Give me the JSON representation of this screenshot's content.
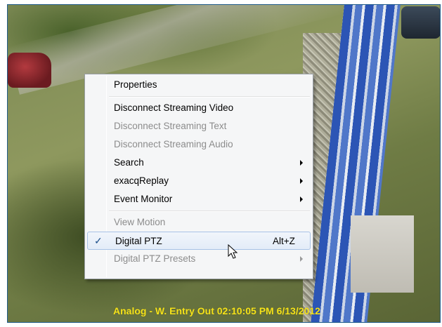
{
  "video": {
    "overlay_caption": "Analog - W. Entry Out 02:10:05 PM 6/13/2012"
  },
  "context_menu": {
    "items": [
      {
        "label": "Properties",
        "disabled": false,
        "submenu": false
      },
      {
        "label": "Disconnect Streaming Video",
        "disabled": false,
        "submenu": false
      },
      {
        "label": "Disconnect Streaming Text",
        "disabled": true,
        "submenu": false
      },
      {
        "label": "Disconnect Streaming Audio",
        "disabled": true,
        "submenu": false
      },
      {
        "label": "Search",
        "disabled": false,
        "submenu": true
      },
      {
        "label": "exacqReplay",
        "disabled": false,
        "submenu": true
      },
      {
        "label": "Event Monitor",
        "disabled": false,
        "submenu": true
      },
      {
        "label": "View Motion",
        "disabled": true,
        "submenu": false
      },
      {
        "label": "Digital PTZ",
        "disabled": false,
        "submenu": false,
        "checked": true,
        "shortcut": "Alt+Z"
      },
      {
        "label": "Digital PTZ Presets",
        "disabled": true,
        "submenu": true
      }
    ],
    "check_glyph": "✓"
  },
  "colors": {
    "overlay_text": "#f6e31a",
    "menu_background": "#f5f6f7",
    "menu_hover_border": "#a8c2e6",
    "frame_border": "#1f5b8a"
  },
  "icons": [
    "checkmark-icon",
    "submenu-arrow-icon",
    "mouse-pointer-icon"
  ]
}
